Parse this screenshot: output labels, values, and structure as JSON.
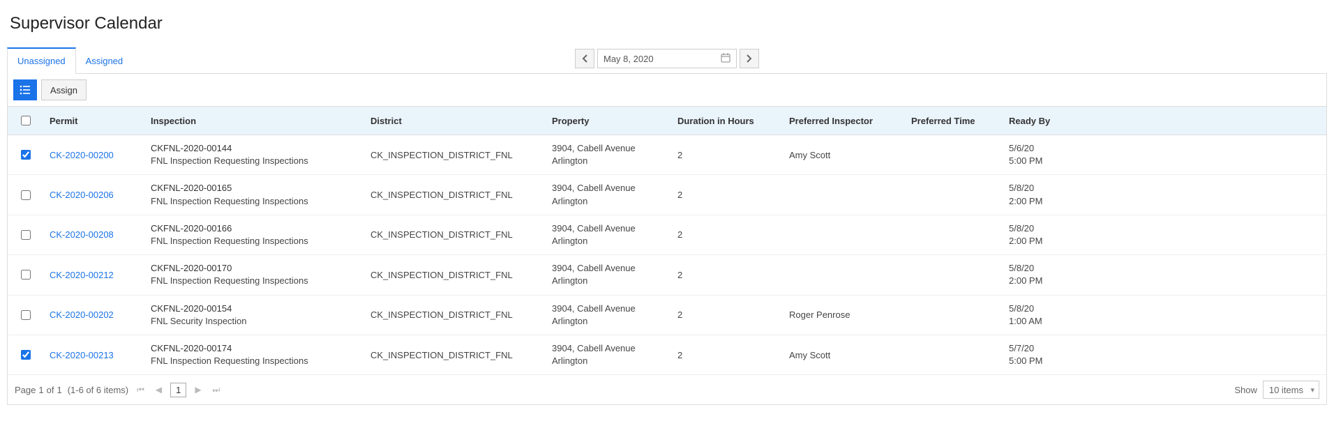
{
  "title": "Supervisor Calendar",
  "tabs": {
    "unassigned": "Unassigned",
    "assigned": "Assigned"
  },
  "date": "May 8, 2020",
  "toolbar": {
    "assign": "Assign"
  },
  "columns": {
    "permit": "Permit",
    "inspection": "Inspection",
    "district": "District",
    "property": "Property",
    "duration": "Duration in Hours",
    "inspector": "Preferred Inspector",
    "preftime": "Preferred Time",
    "readyby": "Ready By"
  },
  "rows": [
    {
      "checked": true,
      "permit": "CK-2020-00200",
      "inspection_id": "CKFNL-2020-00144",
      "inspection_type": "FNL Inspection Requesting Inspections",
      "district": "CK_INSPECTION_DISTRICT_FNL",
      "property_l1": "3904, Cabell Avenue",
      "property_l2": "Arlington",
      "duration": "2",
      "inspector": "Amy Scott",
      "preftime": "",
      "ready_d": "5/6/20",
      "ready_t": "5:00 PM"
    },
    {
      "checked": false,
      "permit": "CK-2020-00206",
      "inspection_id": "CKFNL-2020-00165",
      "inspection_type": "FNL Inspection Requesting Inspections",
      "district": "CK_INSPECTION_DISTRICT_FNL",
      "property_l1": "3904, Cabell Avenue",
      "property_l2": "Arlington",
      "duration": "2",
      "inspector": "",
      "preftime": "",
      "ready_d": "5/8/20",
      "ready_t": "2:00 PM"
    },
    {
      "checked": false,
      "permit": "CK-2020-00208",
      "inspection_id": "CKFNL-2020-00166",
      "inspection_type": "FNL Inspection Requesting Inspections",
      "district": "CK_INSPECTION_DISTRICT_FNL",
      "property_l1": "3904, Cabell Avenue",
      "property_l2": "Arlington",
      "duration": "2",
      "inspector": "",
      "preftime": "",
      "ready_d": "5/8/20",
      "ready_t": "2:00 PM"
    },
    {
      "checked": false,
      "permit": "CK-2020-00212",
      "inspection_id": "CKFNL-2020-00170",
      "inspection_type": "FNL Inspection Requesting Inspections",
      "district": "CK_INSPECTION_DISTRICT_FNL",
      "property_l1": "3904, Cabell Avenue",
      "property_l2": "Arlington",
      "duration": "2",
      "inspector": "",
      "preftime": "",
      "ready_d": "5/8/20",
      "ready_t": "2:00 PM"
    },
    {
      "checked": false,
      "permit": "CK-2020-00202",
      "inspection_id": "CKFNL-2020-00154",
      "inspection_type": "FNL Security Inspection",
      "district": "CK_INSPECTION_DISTRICT_FNL",
      "property_l1": "3904, Cabell Avenue",
      "property_l2": "Arlington",
      "duration": "2",
      "inspector": "Roger Penrose",
      "preftime": "",
      "ready_d": "5/8/20",
      "ready_t": "1:00 AM"
    },
    {
      "checked": true,
      "permit": "CK-2020-00213",
      "inspection_id": "CKFNL-2020-00174",
      "inspection_type": "FNL Inspection Requesting Inspections",
      "district": "CK_INSPECTION_DISTRICT_FNL",
      "property_l1": "3904, Cabell Avenue",
      "property_l2": "Arlington",
      "duration": "2",
      "inspector": "Amy Scott",
      "preftime": "",
      "ready_d": "5/7/20",
      "ready_t": "5:00 PM"
    }
  ],
  "footer": {
    "page_label": "Page",
    "page_current": "1",
    "page_of": "of",
    "page_total": "1",
    "range": "(1-6 of 6 items)",
    "show_label": "Show",
    "show_value": "10 items"
  }
}
